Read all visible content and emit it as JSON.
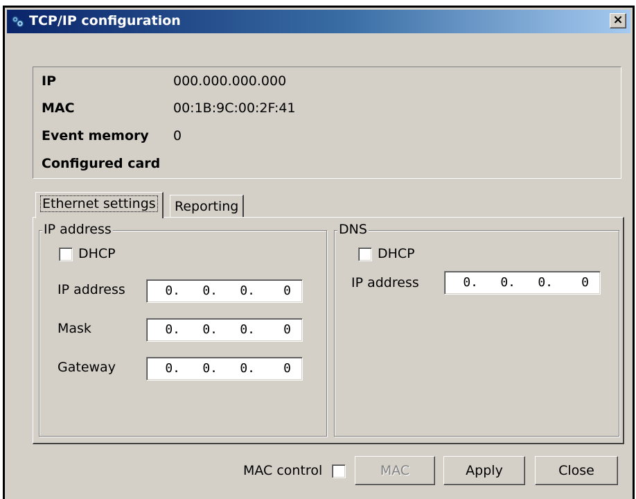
{
  "window": {
    "title": "TCP/IP configuration",
    "close_glyph": "×"
  },
  "info": {
    "ip_label": "IP",
    "ip_value": "000.000.000.000",
    "mac_label": "MAC",
    "mac_value": "00:1B:9C:00:2F:41",
    "event_memory_label": "Event memory",
    "event_memory_value": "0",
    "configured_card_label": "Configured card",
    "configured_card_value": ""
  },
  "tabs": [
    {
      "label": "Ethernet settings",
      "active": true
    },
    {
      "label": "Reporting",
      "active": false
    }
  ],
  "ip_group": {
    "title": "IP address",
    "dhcp_label": "DHCP",
    "dhcp_checked": false,
    "ip_label": "IP address",
    "ip_octets": [
      "0.",
      "0.",
      "0.",
      "0"
    ],
    "mask_label": "Mask",
    "mask_octets": [
      "0.",
      "0.",
      "0.",
      "0"
    ],
    "gateway_label": "Gateway",
    "gateway_octets": [
      "0.",
      "0.",
      "0.",
      "0"
    ]
  },
  "dns_group": {
    "title": "DNS",
    "dhcp_label": "DHCP",
    "dhcp_checked": false,
    "ip_label": "IP address",
    "ip_octets": [
      "0.",
      "0.",
      "0.",
      "0"
    ]
  },
  "footer": {
    "mac_control_label": "MAC control",
    "mac_control_checked": false,
    "mac_button": "MAC",
    "apply_button": "Apply",
    "close_button": "Close"
  },
  "colors": {
    "face": "#d4d0c8",
    "title_start": "#0a246a",
    "title_end": "#a6caf0",
    "disabled_text": "#808080"
  },
  "icons": {
    "title": "tcp-ip-network-icon",
    "close": "close-icon"
  }
}
